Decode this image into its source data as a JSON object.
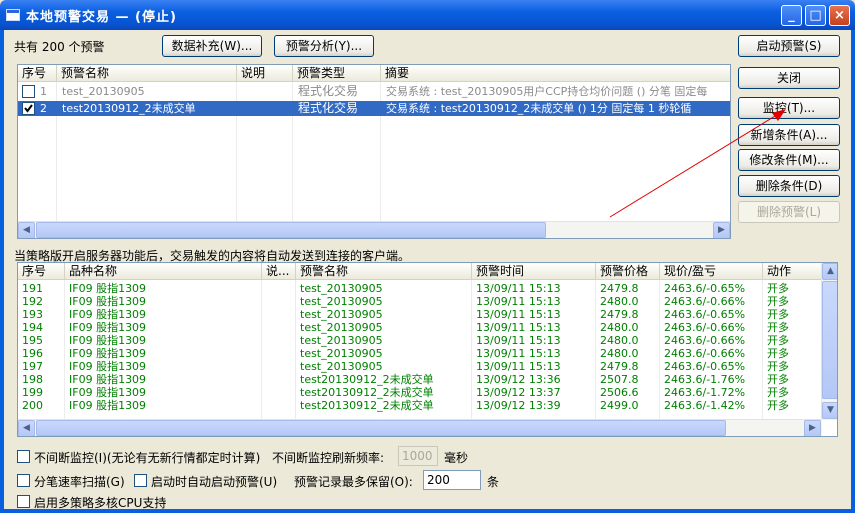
{
  "window": {
    "title": "本地预警交易 — (停止)",
    "min": "_",
    "max": "□",
    "close": "×"
  },
  "header": {
    "count_text": "共有 200 个预警",
    "data_fill_label": "数据补充(W)...",
    "analysis_label": "预警分析(Y)...",
    "start_label": "启动预警(S)"
  },
  "top_table": {
    "columns": [
      "序号",
      "预警名称",
      "说明",
      "预警类型",
      "摘要"
    ],
    "rows": [
      {
        "no": "1",
        "name": "test_20130905",
        "desc": "",
        "type": "程式化交易",
        "summary": "交易系统 : test_20130905用户CCP持仓均价问题 () 分笔 固定每",
        "checked": false,
        "selected": false
      },
      {
        "no": "2",
        "name": "test20130912_2未成交单",
        "desc": "",
        "type": "程式化交易",
        "summary": "交易系统 : test20130912_2未成交单 () 1分 固定每 1 秒轮循",
        "checked": true,
        "selected": true
      }
    ]
  },
  "side_buttons": {
    "close": "关闭",
    "monitor": "监控(T)...",
    "add_condition": "新增条件(A)...",
    "edit_condition": "修改条件(M)...",
    "delete_condition": "删除条件(D)",
    "delete_warning": "删除预警(L)"
  },
  "info_text": "当策略版开启服务器功能后，交易触发的内容将自动发送到连接的客户端。",
  "bottom_table": {
    "columns": [
      "序号",
      "品种名称",
      "说...",
      "预警名称",
      "预警时间",
      "预警价格",
      "现价/盈亏",
      "动作"
    ],
    "rows": [
      [
        "191",
        "IF09 股指1309",
        "",
        "test_20130905",
        "13/09/11 15:13",
        "2479.8",
        "2463.6/-0.65%",
        "开多"
      ],
      [
        "192",
        "IF09 股指1309",
        "",
        "test_20130905",
        "13/09/11 15:13",
        "2480.0",
        "2463.6/-0.66%",
        "开多"
      ],
      [
        "193",
        "IF09 股指1309",
        "",
        "test_20130905",
        "13/09/11 15:13",
        "2479.8",
        "2463.6/-0.65%",
        "开多"
      ],
      [
        "194",
        "IF09 股指1309",
        "",
        "test_20130905",
        "13/09/11 15:13",
        "2480.0",
        "2463.6/-0.66%",
        "开多"
      ],
      [
        "195",
        "IF09 股指1309",
        "",
        "test_20130905",
        "13/09/11 15:13",
        "2480.0",
        "2463.6/-0.66%",
        "开多"
      ],
      [
        "196",
        "IF09 股指1309",
        "",
        "test_20130905",
        "13/09/11 15:13",
        "2480.0",
        "2463.6/-0.66%",
        "开多"
      ],
      [
        "197",
        "IF09 股指1309",
        "",
        "test_20130905",
        "13/09/11 15:13",
        "2479.8",
        "2463.6/-0.65%",
        "开多"
      ],
      [
        "198",
        "IF09 股指1309",
        "",
        "test20130912_2未成交单",
        "13/09/12 13:36",
        "2507.8",
        "2463.6/-1.76%",
        "开多"
      ],
      [
        "199",
        "IF09 股指1309",
        "",
        "test20130912_2未成交单",
        "13/09/12 13:37",
        "2506.6",
        "2463.6/-1.72%",
        "开多"
      ],
      [
        "200",
        "IF09 股指1309",
        "",
        "test20130912_2未成交单",
        "13/09/12 13:39",
        "2499.0",
        "2463.6/-1.42%",
        "开多"
      ]
    ]
  },
  "options": {
    "continuous_label": "不间断监控(I)(无论有无新行情都定时计算)",
    "refresh_label": "不间断监控刷新频率:",
    "refresh_value": "1000",
    "refresh_unit": "毫秒",
    "tick_scan_label": "分笔速率扫描(G)",
    "auto_start_label": "启动时自动启动预警(U)",
    "record_label": "预警记录最多保留(O):",
    "record_value": "200",
    "record_unit": "条",
    "multicore_label": "启用多策略多核CPU支持"
  },
  "colors": {
    "row_text": "#008000",
    "selection": "#316ac5",
    "annotation_arrow": "#e00000"
  }
}
